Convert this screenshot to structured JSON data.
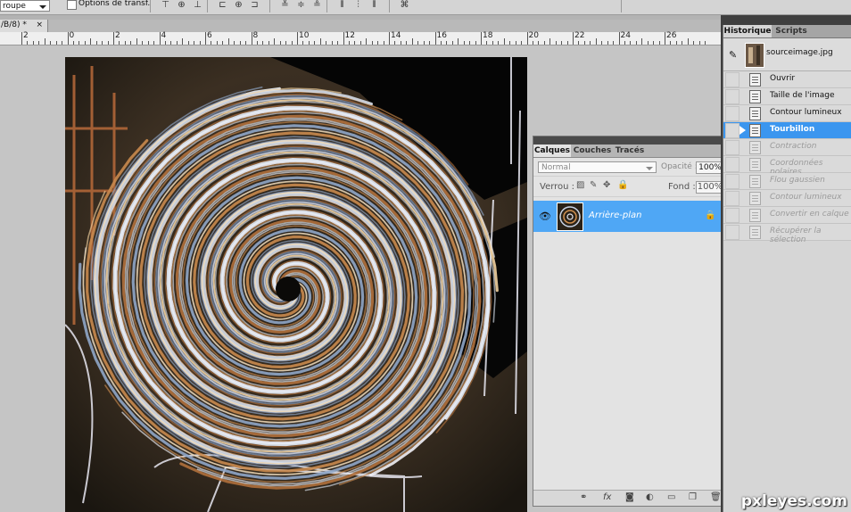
{
  "options_bar": {
    "group_select_value": "roupe",
    "transform_checkbox_label": "Options de transf."
  },
  "document": {
    "tab_title": "/B/8) *",
    "close_glyph": "×"
  },
  "ruler": {
    "labels": [
      "2",
      "0",
      "2",
      "4",
      "6",
      "8",
      "10",
      "12",
      "14",
      "16",
      "18",
      "20",
      "22",
      "24",
      "26"
    ]
  },
  "layers_panel": {
    "tabs": [
      {
        "label": "Calques",
        "active": true
      },
      {
        "label": "Couches",
        "active": false
      },
      {
        "label": "Tracés",
        "active": false
      }
    ],
    "blend_mode": "Normal",
    "opacity_label": "Opacité :",
    "opacity_value": "100%",
    "lock_label": "Verrou :",
    "fill_label": "Fond :",
    "fill_value": "100%",
    "layer": {
      "name": "Arrière-plan",
      "visible": true,
      "locked": true
    },
    "collapse_glyph": "◂◂",
    "menu_glyph": "▾≡",
    "footer_icons": [
      "link-icon",
      "fx-icon",
      "mask-icon",
      "adjustment-icon",
      "group-folder-icon",
      "new-layer-icon",
      "trash-icon"
    ]
  },
  "history_panel": {
    "tabs": [
      {
        "label": "Historique",
        "active": true
      },
      {
        "label": "Scripts",
        "active": false
      }
    ],
    "snapshot_name": "sourceimage.jpg",
    "states": [
      {
        "label": "Ouvrir",
        "state": "done"
      },
      {
        "label": "Taille de l'image",
        "state": "done"
      },
      {
        "label": "Contour lumineux",
        "state": "done"
      },
      {
        "label": "Tourbillon",
        "state": "active"
      },
      {
        "label": "Contraction",
        "state": "undone"
      },
      {
        "label": "Coordonnées polaires",
        "state": "undone"
      },
      {
        "label": "Flou gaussien",
        "state": "undone"
      },
      {
        "label": "Contour lumineux",
        "state": "undone"
      },
      {
        "label": "Convertir en calque",
        "state": "undone"
      },
      {
        "label": "Récupérer la sélection",
        "state": "undone"
      }
    ]
  },
  "watermark": "pxleyes.com",
  "colors": {
    "selection_blue": "#4fa7f5",
    "history_active": "#3b96ef",
    "panel_gray": "#e3e3e3",
    "dock_dark": "#3f3f3f"
  }
}
